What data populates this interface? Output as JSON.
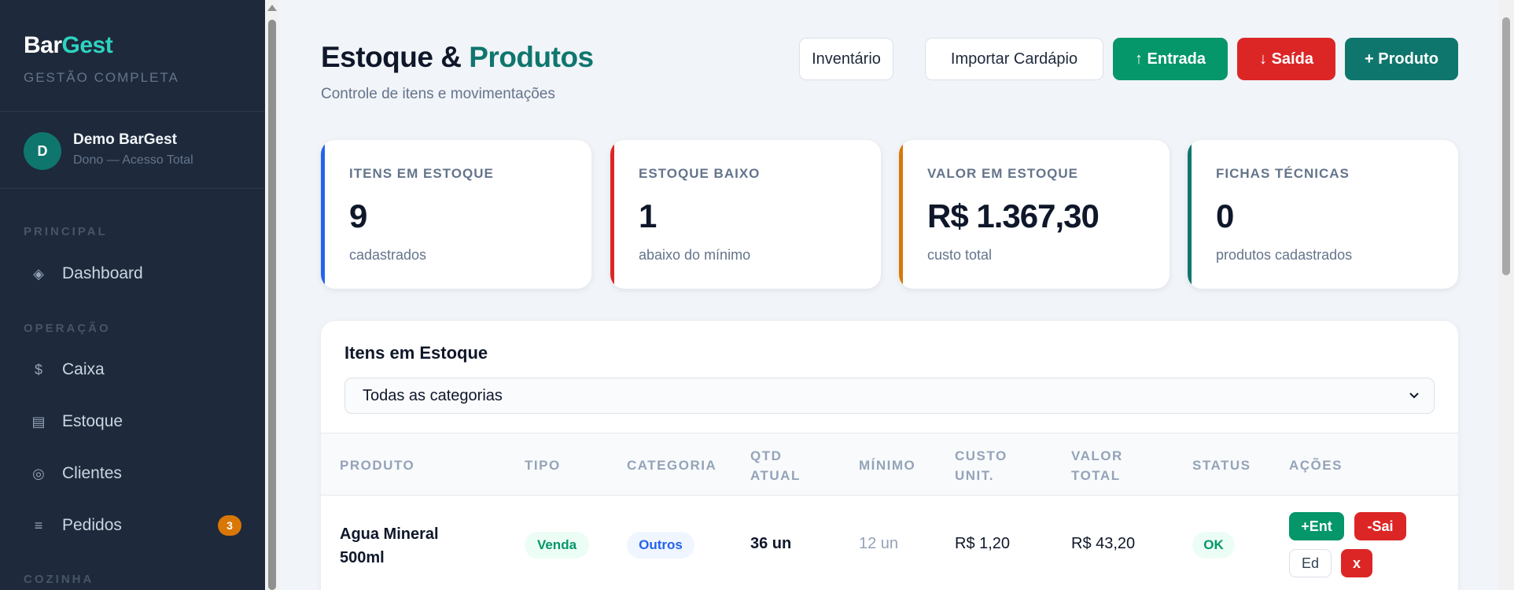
{
  "sidebar": {
    "brand_primary": "Bar",
    "brand_accent": "Gest",
    "brand_subtitle": "GESTÃO COMPLETA",
    "user": {
      "initial": "D",
      "name": "Demo BarGest",
      "role": "Dono — Acesso Total"
    },
    "sections": {
      "principal": "PRINCIPAL",
      "operacao": "OPERAÇÃO",
      "cozinha": "COZINHA"
    },
    "items": [
      {
        "label": "Dashboard",
        "icon": "◈"
      },
      {
        "label": "Caixa",
        "icon": "$"
      },
      {
        "label": "Estoque",
        "icon": "▤"
      },
      {
        "label": "Clientes",
        "icon": "◎"
      },
      {
        "label": "Pedidos",
        "icon": "≡",
        "badge": "3"
      }
    ]
  },
  "header": {
    "title_primary": "Estoque &",
    "title_accent": "Produtos",
    "subtitle": "Controle de itens e movimentações",
    "buttons": {
      "inventario": "Inventário",
      "importar": "Importar Cardápio",
      "entrada": "↑ Entrada",
      "saida": "↓ Saída",
      "produto": "+ Produto"
    }
  },
  "stats": [
    {
      "label": "ITENS EM ESTOQUE",
      "value": "9",
      "note": "cadastrados",
      "color": "#2563eb"
    },
    {
      "label": "ESTOQUE BAIXO",
      "value": "1",
      "note": "abaixo do mínimo",
      "color": "#dc2626"
    },
    {
      "label": "VALOR EM ESTOQUE",
      "value": "R$ 1.367,30",
      "note": "custo total",
      "color": "#d97706"
    },
    {
      "label": "FICHAS TÉCNICAS",
      "value": "0",
      "note": "produtos cadastrados",
      "color": "#0f766e"
    }
  ],
  "table": {
    "title": "Itens em Estoque",
    "filter_value": "Todas as categorias",
    "columns": {
      "produto": "PRODUTO",
      "tipo": "TIPO",
      "categoria": "CATEGORIA",
      "qtd_1": "QTD",
      "qtd_2": "ATUAL",
      "minimo": "MÍNIMO",
      "custo_1": "CUSTO",
      "custo_2": "UNIT.",
      "valor_1": "VALOR",
      "valor_2": "TOTAL",
      "status": "STATUS",
      "acoes": "AÇÕES"
    },
    "rows": [
      {
        "produto_1": "Agua Mineral",
        "produto_2": "500ml",
        "tipo": "Venda",
        "categoria": "Outros",
        "qtd": "36 un",
        "minimo": "12 un",
        "custo": "R$ 1,20",
        "valor": "R$ 43,20",
        "status": "OK",
        "actions": {
          "ent": "+Ent",
          "sai": "-Sai",
          "ed": "Ed",
          "del": "x"
        }
      }
    ]
  }
}
